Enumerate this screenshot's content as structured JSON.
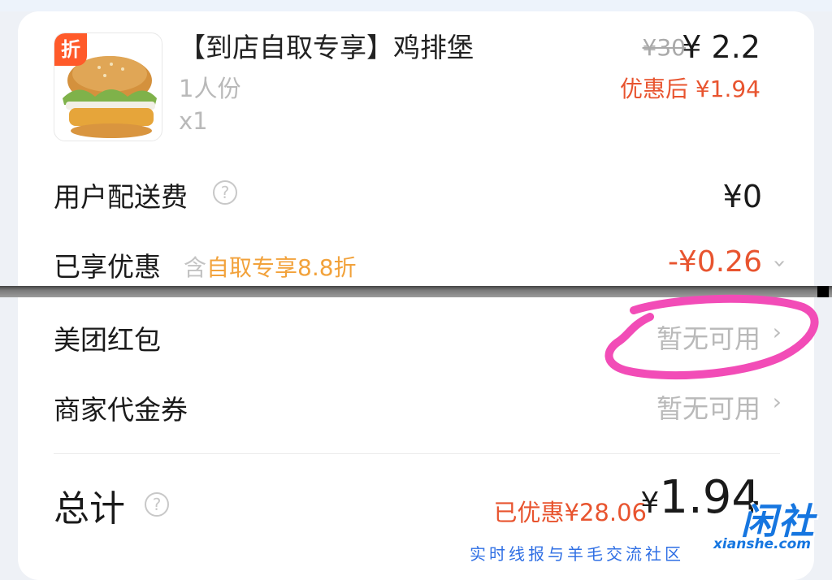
{
  "item": {
    "tag": "折",
    "title": "【到店自取专享】鸡排堡",
    "portion": "1人份",
    "quantity": "x1",
    "original_price": "¥30",
    "price": "¥ 2.2",
    "after_discount": "优惠后 ¥1.94"
  },
  "fees": {
    "delivery_label": "用户配送费",
    "delivery_value": "¥0"
  },
  "discount": {
    "label": "已享优惠",
    "note_prefix": "含",
    "note_highlight": "自取专享8.8折",
    "value": "-¥0.26"
  },
  "coupons": [
    {
      "label": "美团红包",
      "value": "暂无可用"
    },
    {
      "label": "商家代金券",
      "value": "暂无可用"
    }
  ],
  "total": {
    "label": "总计",
    "saved": "已优惠¥28.06",
    "currency": "¥",
    "amount": "1.94"
  },
  "watermark": {
    "logo": "闲社",
    "site": "xianshe.com",
    "slogan": "实时线报与羊毛交流社区"
  },
  "colors": {
    "accent_red": "#e8542f",
    "highlight_orange": "#f2a23b",
    "annotation_pink": "#f24cb7"
  }
}
